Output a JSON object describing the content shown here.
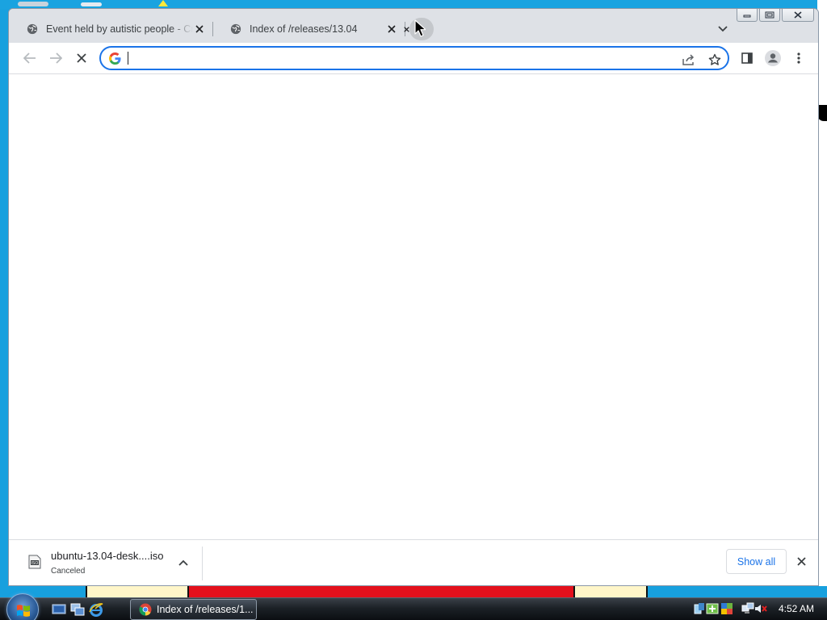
{
  "browser": {
    "tabs": [
      {
        "title": "Event held by autistic people - Cr",
        "active": false
      },
      {
        "title": "Index of /releases/13.04",
        "active": true
      },
      {
        "title": "",
        "active": false
      }
    ],
    "omnibox": {
      "value": "",
      "placeholder": ""
    }
  },
  "downloads": {
    "items": [
      {
        "filename": "ubuntu-13.04-desk....iso",
        "status": "Canceled",
        "icon": "iso-file-icon"
      }
    ],
    "show_all_label": "Show all"
  },
  "taskbar": {
    "window_button": {
      "label": "Index of /releases/1..."
    },
    "clock": "4:52 AM"
  },
  "colors": {
    "accent": "#1a73e8",
    "tabstrip": "#dee1e6",
    "desktop": "#17a0de"
  }
}
